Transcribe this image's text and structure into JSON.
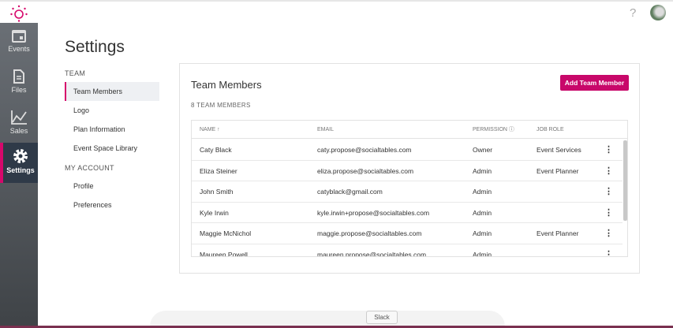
{
  "topbar": {
    "help_label": "?",
    "brand_color": "#d6086b"
  },
  "sidebar": {
    "items": [
      {
        "label": "Events",
        "icon": "calendar-icon"
      },
      {
        "label": "Files",
        "icon": "file-icon"
      },
      {
        "label": "Sales",
        "icon": "chart-icon"
      },
      {
        "label": "Settings",
        "icon": "gear-icon",
        "active": true
      }
    ]
  },
  "page": {
    "title": "Settings"
  },
  "menu": {
    "team_header": "TEAM",
    "team_items": [
      "Team Members",
      "Logo",
      "Plan Information",
      "Event Space Library"
    ],
    "account_header": "MY ACCOUNT",
    "account_items": [
      "Profile",
      "Preferences"
    ]
  },
  "card": {
    "title": "Team Members",
    "count": "8 TEAM MEMBERS",
    "add_button": "Add Team Member"
  },
  "table": {
    "headers": [
      "NAME ↑",
      "EMAIL",
      "PERMISSION ⓘ",
      "JOB ROLE"
    ],
    "rows": [
      [
        "Caty Black",
        "caty.propose@socialtables.com",
        "Owner",
        "Event Services"
      ],
      [
        "Eliza Steiner",
        "eliza.propose@socialtables.com",
        "Admin",
        "Event Planner"
      ],
      [
        "John Smith",
        "catyblack@gmail.com",
        "Admin",
        ""
      ],
      [
        "Kyle Irwin",
        "kyle.irwin+propose@socialtables.com",
        "Admin",
        ""
      ],
      [
        "Maggie McNichol",
        "maggie.propose@socialtables.com",
        "Admin",
        "Event Planner"
      ],
      [
        "Maureen Powell",
        "maureen.propose@socialtables.com",
        "Admin",
        ""
      ]
    ],
    "more": "⋮"
  },
  "dock": {
    "tooltip": "Slack"
  }
}
